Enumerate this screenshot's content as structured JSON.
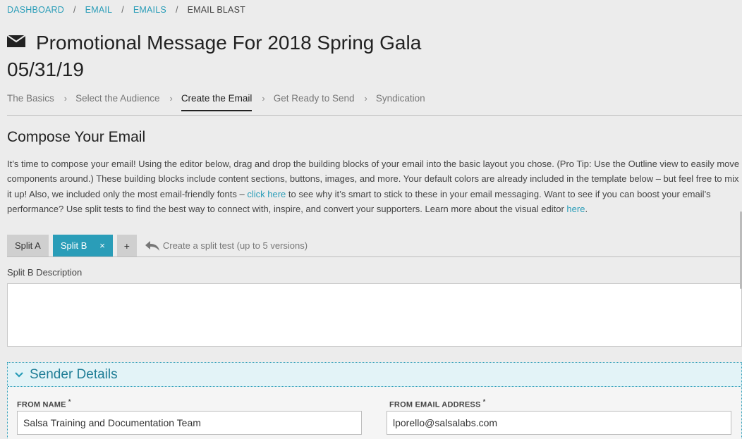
{
  "breadcrumb": {
    "items": [
      "DASHBOARD",
      "EMAIL",
      "EMAILS"
    ],
    "current": "EMAIL BLAST"
  },
  "header": {
    "title": "Promotional Message For 2018 Spring Gala",
    "subtitle": "05/31/19"
  },
  "steps": [
    "The Basics",
    "Select the Audience",
    "Create the Email",
    "Get Ready to Send",
    "Syndication"
  ],
  "active_step": "Create the Email",
  "compose": {
    "heading": "Compose Your Email",
    "intro_part1": "It’s time to compose your email! Using the editor below, drag and drop the building blocks of your email into the basic layout you chose. (Pro Tip: Use the Outline view to easily move components around.) These building blocks include content sections, buttons, images, and more. Your default colors are already included in the template below – but feel free to mix it up! Also, we included only the most email-friendly fonts – ",
    "link1": "click here",
    "intro_part2": " to see why it’s smart to stick to these in your email messaging. Want to see if you can boost your email’s performance? Use split tests to find the best way to connect with, inspire, and convert your supporters. Learn more about the visual editor ",
    "link2": "here",
    "intro_part3": "."
  },
  "split_tabs": {
    "tab_a": "Split A",
    "tab_b": "Split B",
    "close": "×",
    "add": "+",
    "hint": "Create a split test (up to 5 versions)"
  },
  "description": {
    "label": "Split B Description",
    "value": ""
  },
  "sender": {
    "heading": "Sender Details",
    "from_name_label": "FROM NAME",
    "from_name_value": "Salsa Training and Documentation Team",
    "from_email_label": "FROM EMAIL ADDRESS",
    "from_email_value": "lporello@salsalabs.com",
    "required_mark": "*"
  },
  "colors": {
    "accent": "#2a9db8",
    "background": "#ececec"
  }
}
